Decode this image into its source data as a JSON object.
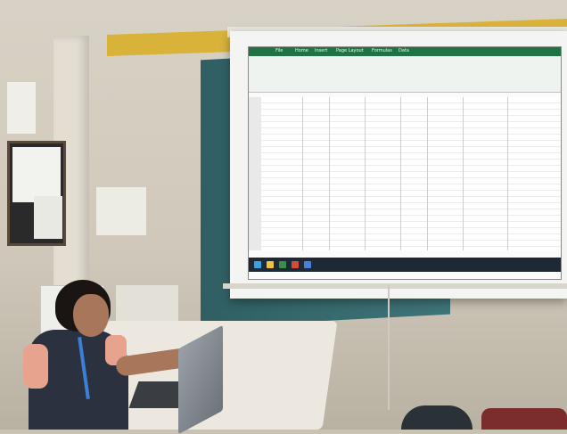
{
  "scene": {
    "description_free": true
  },
  "excel": {
    "app_color": "#217346",
    "tabs": [
      "File",
      "Home",
      "Insert",
      "Page Layout",
      "Formulas",
      "Data"
    ]
  },
  "colors": {
    "wall": "#d8d2c6",
    "beam": "#d9b23a",
    "teal_wall": "#2f5f63"
  }
}
